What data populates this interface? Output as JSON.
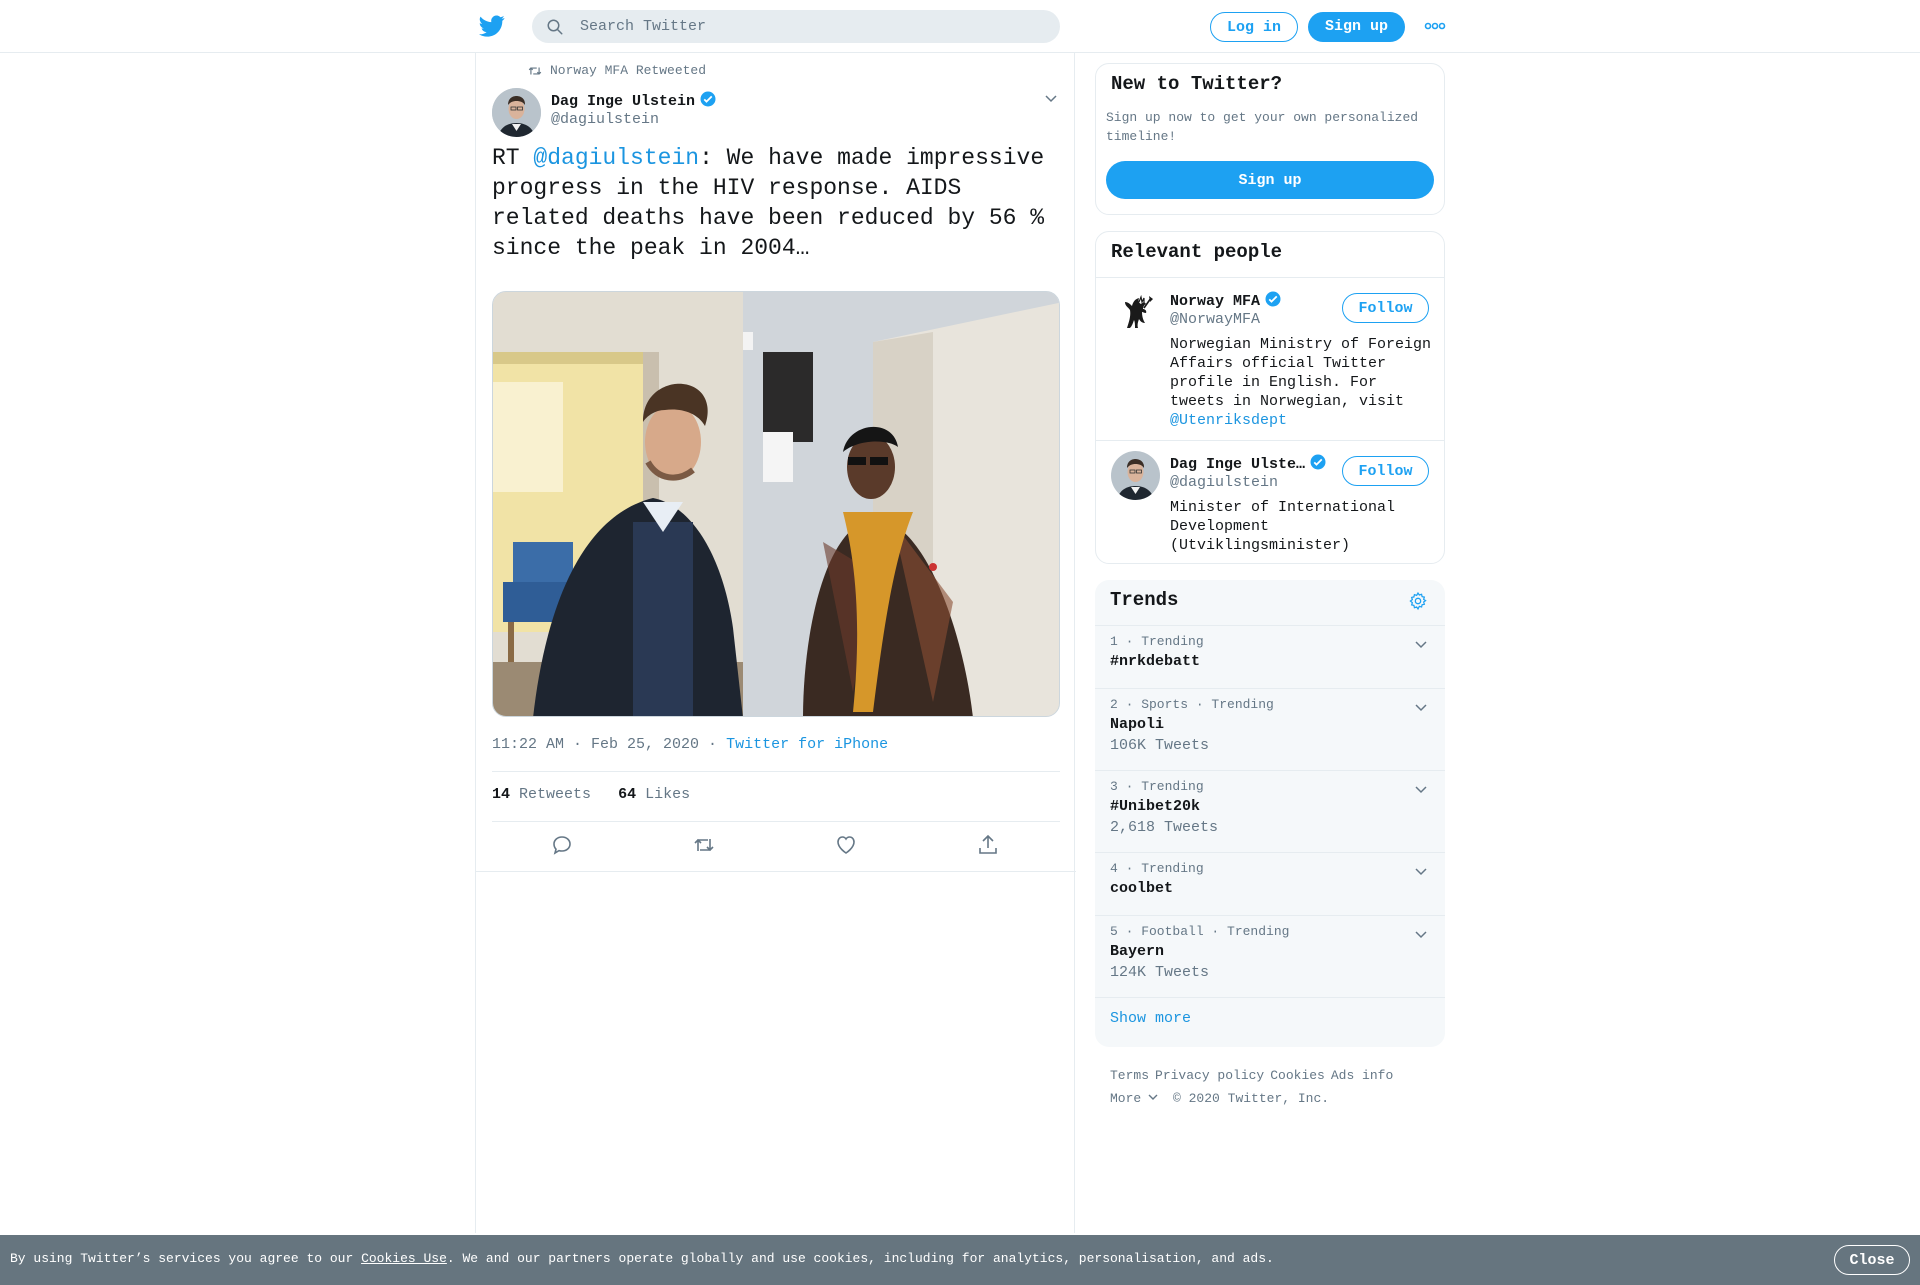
{
  "header": {
    "logo": "twitter-bird-icon",
    "search_placeholder": "Search Twitter",
    "login_label": "Log in",
    "signup_label": "Sign up",
    "more": "more-dots-icon"
  },
  "tweet": {
    "retweeted_by": "Norway MFA Retweeted",
    "author_name": "Dag Inge Ulstein",
    "author_handle": "@dagiulstein",
    "text_prefix": "RT ",
    "text_mention": "@dagiulstein",
    "text_body": ": We have made impressive progress in the HIV response. AIDS related deaths have been reduced by 56 % since the peak in 2004…",
    "time": "11:22 AM · Feb 25, 2020",
    "meta_sep": " · ",
    "source": "Twitter for iPhone",
    "retweets_count": "14",
    "retweets_label": "Retweets",
    "likes_count": "64",
    "likes_label": "Likes"
  },
  "sidebar": {
    "new_title": "New to Twitter?",
    "new_desc": "Sign up now to get your own personalized timeline!",
    "new_signup": "Sign up",
    "people_title": "Relevant people",
    "people": [
      {
        "name": "Norway MFA",
        "handle": "@NorwayMFA",
        "bio": "Norwegian Ministry of Foreign Affairs official Twitter profile in English. For tweets in Norwegian, visit ",
        "bio_link": "@Utenriksdept",
        "follow": "Follow"
      },
      {
        "name": "Dag Inge Ulste…",
        "handle": "@dagiulstein",
        "bio": "Minister of International Development (Utviklingsminister)",
        "follow": "Follow"
      }
    ],
    "trends_title": "Trends",
    "trends": [
      {
        "meta": "1 · Trending",
        "name": "#nrkdebatt",
        "count": ""
      },
      {
        "meta": "2 · Sports · Trending",
        "name": "Napoli",
        "count": "106K Tweets"
      },
      {
        "meta": "3 · Trending",
        "name": "#Unibet20k",
        "count": "2,618 Tweets"
      },
      {
        "meta": "4 · Trending",
        "name": "coolbet",
        "count": ""
      },
      {
        "meta": "5 · Football · Trending",
        "name": "Bayern",
        "count": "124K Tweets"
      }
    ],
    "show_more": "Show more",
    "footer_links": [
      "Terms",
      "Privacy policy",
      "Cookies",
      "Ads info"
    ],
    "footer_more": "More",
    "footer_copyright": "© 2020 Twitter, Inc."
  },
  "cookie": {
    "text_before": "By using Twitter’s services you agree to our ",
    "link": "Cookies Use",
    "text_after": ". We and our partners operate globally and use cookies, including for analytics, personalisation, and ads.",
    "close": "Close"
  },
  "colors": {
    "accent": "#1da1f2",
    "link": "#1b95e0",
    "secondary_text": "#657786",
    "cookie_bar": "#66757f"
  }
}
